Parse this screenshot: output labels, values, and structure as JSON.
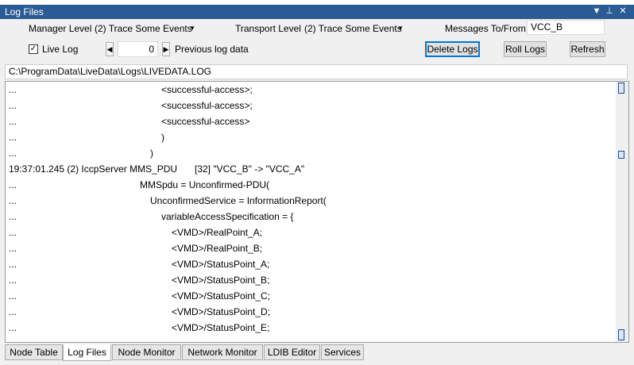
{
  "window": {
    "title": "Log Files"
  },
  "controls": {
    "manager_level_label": "Manager Level",
    "manager_level_value": "(2) Trace Some Events",
    "transport_level_label": "Transport Level",
    "transport_level_value": "(2) Trace Some Events",
    "messages_label": "Messages To/From",
    "messages_value": "VCC_B",
    "live_log_label": "Live Log",
    "live_log_checked": true,
    "previous_value": "0",
    "previous_label": "Previous log data",
    "delete_logs": "Delete Logs",
    "roll_logs": "Roll Logs",
    "refresh": "Refresh"
  },
  "path": "C:\\ProgramData\\LiveData\\Logs\\LIVEDATA.LOG",
  "log_lines": [
    {
      "prefix": "...",
      "text": "<successful-access>;"
    },
    {
      "prefix": "...",
      "text": "<successful-access>;"
    },
    {
      "prefix": "...",
      "text": "<successful-access>"
    },
    {
      "prefix": "...",
      "text": ")"
    },
    {
      "prefix": "...",
      "text": ")"
    },
    {
      "prefix": "19:37:01.245 (2) IccpServer MMS_PDU",
      "text": "[32] \"VCC_B\" -> \"VCC_A\""
    },
    {
      "prefix": "...",
      "text": "MMSpdu = Unconfirmed-PDU("
    },
    {
      "prefix": "...",
      "text": "UnconfirmedService = InformationReport("
    },
    {
      "prefix": "...",
      "text": "variableAccessSpecification = {"
    },
    {
      "prefix": "...",
      "text": "<VMD>/RealPoint_A;"
    },
    {
      "prefix": "...",
      "text": "<VMD>/RealPoint_B;"
    },
    {
      "prefix": "...",
      "text": "<VMD>/StatusPoint_A;"
    },
    {
      "prefix": "...",
      "text": "<VMD>/StatusPoint_B;"
    },
    {
      "prefix": "...",
      "text": "<VMD>/StatusPoint_C;"
    },
    {
      "prefix": "...",
      "text": "<VMD>/StatusPoint_D;"
    },
    {
      "prefix": "...",
      "text": "<VMD>/StatusPoint_E;"
    }
  ],
  "tabs": [
    "Node Table",
    "Log Files",
    "Node Monitor",
    "Network Monitor",
    "LDIB Editor",
    "Services"
  ],
  "active_tab": "Log Files",
  "icons": {
    "dropdown": "dropdown-arrow-icon",
    "pin": "pin-icon",
    "close": "close-icon"
  }
}
